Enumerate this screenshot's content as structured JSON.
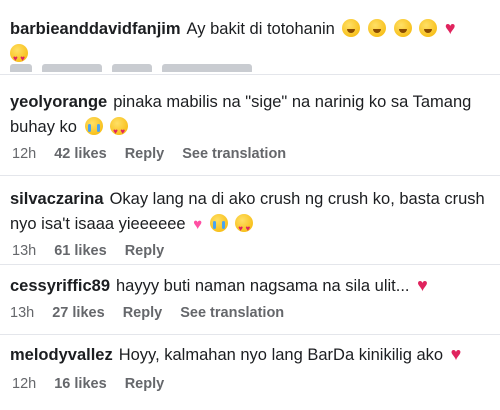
{
  "comments": [
    {
      "user": "barbieanddavidfanjim",
      "text": "Ay bakit di totohanin",
      "emojis": [
        "face-hand-over-mouth-icon",
        "rofl-icon",
        "rofl-icon",
        "rofl-icon",
        "red-heart-icon",
        "heart-eyes-icon"
      ]
    },
    {
      "user": "yeolyorange",
      "text_line1": "pinaka mabilis na \"sige\" na narinig ko sa Tamang",
      "text_line2": "buhay ko",
      "time": "12h",
      "likes": "42 likes",
      "reply": "Reply",
      "see_translation": "See translation"
    },
    {
      "user": "silvaczarina",
      "text_line1": "Okay lang na di ako crush ng crush ko, basta crush",
      "text_line2": "nyo isa't isaaa yieeeeee",
      "time": "13h",
      "likes": "61 likes",
      "reply": "Reply"
    },
    {
      "user": "cessyriffic89",
      "text": "hayyy buti naman nagsama na sila ulit...",
      "time": "13h",
      "likes": "27 likes",
      "reply": "Reply",
      "see_translation": "See translation"
    },
    {
      "user": "melodyvallez",
      "text": "Hoyy, kalmahan nyo lang BarDa kinikilig ako",
      "time": "12h",
      "likes": "16 likes",
      "reply": "Reply"
    }
  ],
  "colors": {
    "meta": "#65676b",
    "heart": "#e0245e",
    "text": "#1c1e21"
  }
}
